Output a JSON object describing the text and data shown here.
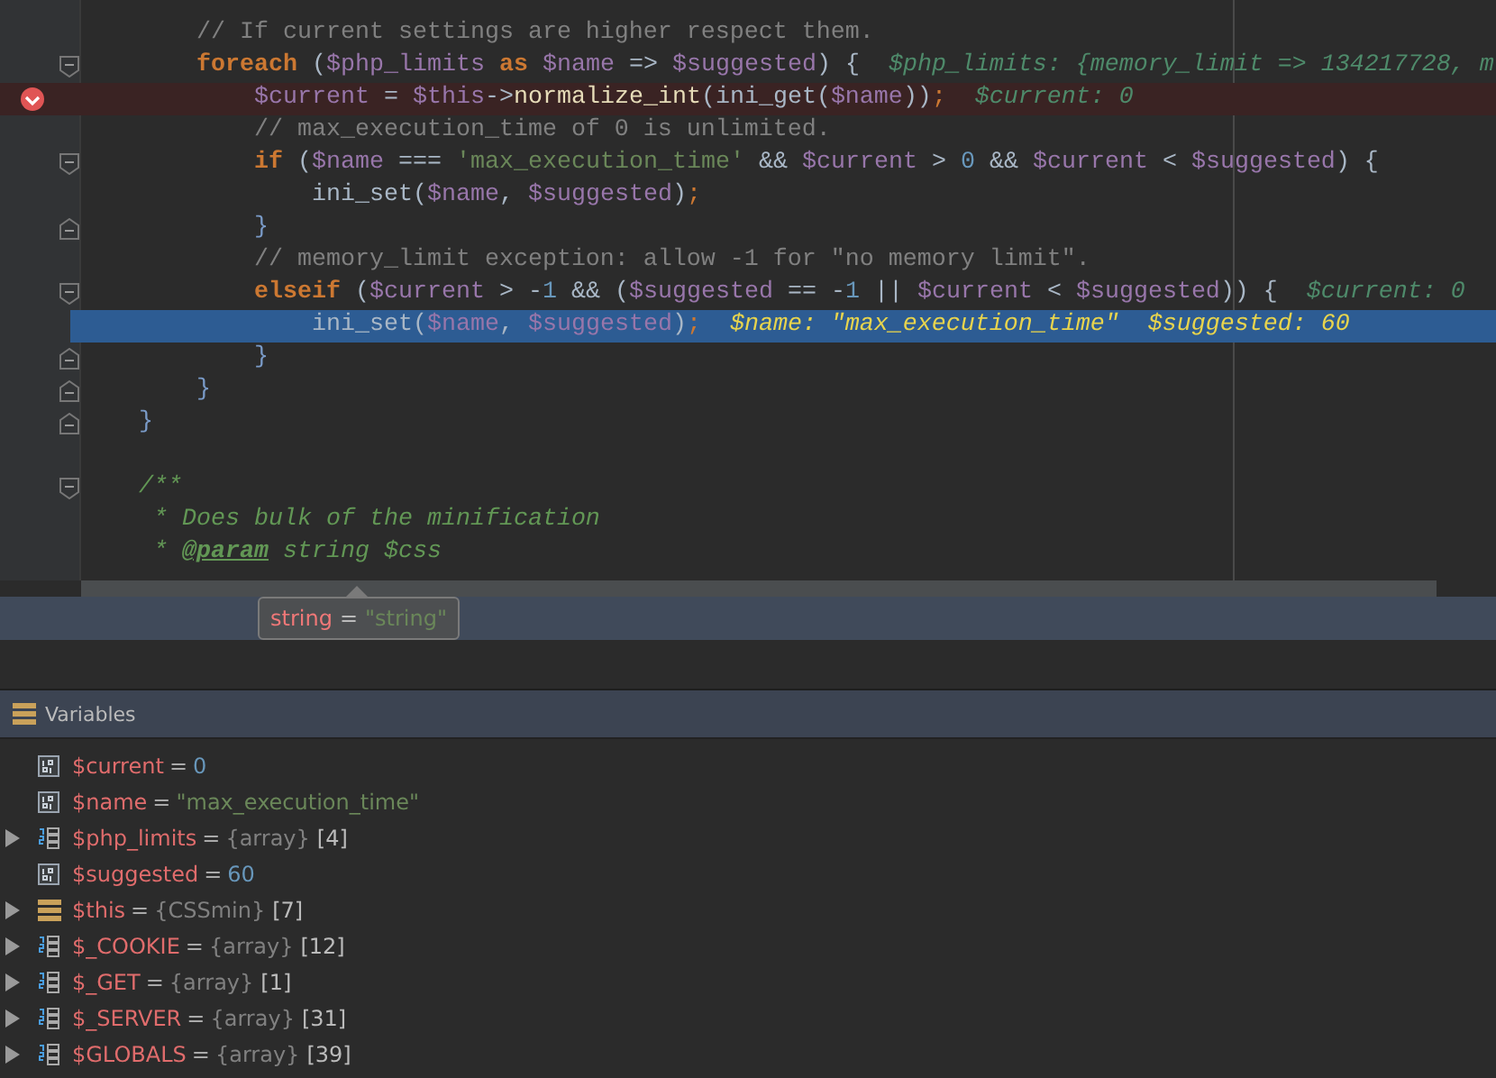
{
  "editor": {
    "lines": [
      {
        "kind": "code",
        "breakpoint": false,
        "current": false,
        "tokens": [
          {
            "kind": "comment",
            "text": "        // If current settings are higher respect them."
          }
        ]
      },
      {
        "kind": "fold-start",
        "breakpoint": false,
        "current": false,
        "tokens": [
          {
            "kind": "keyword",
            "text": "        foreach"
          },
          {
            "kind": "plain",
            "text": " ("
          },
          {
            "kind": "var",
            "text": "$php_limits"
          },
          {
            "kind": "keyword",
            "text": " as "
          },
          {
            "kind": "var",
            "text": "$name"
          },
          {
            "kind": "plain",
            "text": " => "
          },
          {
            "kind": "var",
            "text": "$suggested"
          },
          {
            "kind": "plain",
            "text": ") {"
          },
          {
            "kind": "hint",
            "text": "  $php_limits: {memory_limit => 134217728, m"
          }
        ]
      },
      {
        "kind": "code",
        "breakpoint": true,
        "current": false,
        "tokens": [
          {
            "kind": "var",
            "text": "            $current"
          },
          {
            "kind": "plain",
            "text": " = "
          },
          {
            "kind": "var",
            "text": "$this"
          },
          {
            "kind": "plain",
            "text": "->"
          },
          {
            "kind": "method",
            "text": "normalize_int"
          },
          {
            "kind": "plain",
            "text": "(ini_get("
          },
          {
            "kind": "var",
            "text": "$name"
          },
          {
            "kind": "plain",
            "text": "))"
          },
          {
            "kind": "keyword-plain",
            "text": ";"
          },
          {
            "kind": "hint",
            "text": "  $current: 0"
          }
        ]
      },
      {
        "kind": "code",
        "breakpoint": false,
        "current": false,
        "tokens": [
          {
            "kind": "comment",
            "text": "            // max_execution_time of 0 is unlimited."
          }
        ]
      },
      {
        "kind": "fold-start",
        "breakpoint": false,
        "current": false,
        "tokens": [
          {
            "kind": "keyword",
            "text": "            if"
          },
          {
            "kind": "plain",
            "text": " ("
          },
          {
            "kind": "var",
            "text": "$name"
          },
          {
            "kind": "plain",
            "text": " === "
          },
          {
            "kind": "string",
            "text": "'max_execution_time'"
          },
          {
            "kind": "plain",
            "text": " && "
          },
          {
            "kind": "var",
            "text": "$current"
          },
          {
            "kind": "plain",
            "text": " > "
          },
          {
            "kind": "number",
            "text": "0"
          },
          {
            "kind": "plain",
            "text": " && "
          },
          {
            "kind": "var",
            "text": "$current"
          },
          {
            "kind": "plain",
            "text": " < "
          },
          {
            "kind": "var",
            "text": "$suggested"
          },
          {
            "kind": "plain",
            "text": ") {"
          }
        ]
      },
      {
        "kind": "code",
        "breakpoint": false,
        "current": false,
        "tokens": [
          {
            "kind": "plain",
            "text": "                ini_set("
          },
          {
            "kind": "var",
            "text": "$name"
          },
          {
            "kind": "plain",
            "text": ", "
          },
          {
            "kind": "var",
            "text": "$suggested"
          },
          {
            "kind": "plain",
            "text": ")"
          },
          {
            "kind": "keyword-plain",
            "text": ";"
          }
        ]
      },
      {
        "kind": "fold-end",
        "breakpoint": false,
        "current": false,
        "tokens": [
          {
            "kind": "brace",
            "text": "            }"
          }
        ]
      },
      {
        "kind": "code",
        "breakpoint": false,
        "current": false,
        "tokens": [
          {
            "kind": "comment",
            "text": "            // memory_limit exception: allow -1 for \"no memory limit\"."
          }
        ]
      },
      {
        "kind": "fold-start",
        "breakpoint": false,
        "current": false,
        "tokens": [
          {
            "kind": "keyword",
            "text": "            elseif"
          },
          {
            "kind": "plain",
            "text": " ("
          },
          {
            "kind": "var",
            "text": "$current"
          },
          {
            "kind": "plain",
            "text": " > -"
          },
          {
            "kind": "number",
            "text": "1"
          },
          {
            "kind": "plain",
            "text": " && ("
          },
          {
            "kind": "var",
            "text": "$suggested"
          },
          {
            "kind": "plain",
            "text": " == -"
          },
          {
            "kind": "number",
            "text": "1"
          },
          {
            "kind": "plain",
            "text": " || "
          },
          {
            "kind": "var",
            "text": "$current"
          },
          {
            "kind": "plain",
            "text": " < "
          },
          {
            "kind": "var",
            "text": "$suggested"
          },
          {
            "kind": "plain",
            "text": ")) {"
          },
          {
            "kind": "hint",
            "text": "  $current: 0"
          }
        ]
      },
      {
        "kind": "code",
        "breakpoint": false,
        "current": true,
        "tokens": [
          {
            "kind": "plain",
            "text": "                ini_set("
          },
          {
            "kind": "var",
            "text": "$name"
          },
          {
            "kind": "plain",
            "text": ", "
          },
          {
            "kind": "var",
            "text": "$suggested"
          },
          {
            "kind": "plain",
            "text": ")"
          },
          {
            "kind": "keyword-plain",
            "text": ";"
          },
          {
            "kind": "exec-hint",
            "text": "  $name: \"max_execution_time\"  $suggested: 60"
          }
        ]
      },
      {
        "kind": "fold-end",
        "breakpoint": false,
        "current": false,
        "tokens": [
          {
            "kind": "brace",
            "text": "            }"
          }
        ]
      },
      {
        "kind": "fold-end",
        "breakpoint": false,
        "current": false,
        "tokens": [
          {
            "kind": "brace",
            "text": "        }"
          }
        ]
      },
      {
        "kind": "fold-end",
        "breakpoint": false,
        "current": false,
        "tokens": [
          {
            "kind": "brace",
            "text": "    }"
          }
        ]
      },
      {
        "kind": "blank",
        "breakpoint": false,
        "current": false
      },
      {
        "kind": "fold-start",
        "breakpoint": false,
        "current": false,
        "tokens": [
          {
            "kind": "doc",
            "text": "    /**"
          }
        ]
      },
      {
        "kind": "code",
        "breakpoint": false,
        "current": false,
        "tokens": [
          {
            "kind": "doc",
            "text": "     * Does bulk of the minification"
          }
        ]
      },
      {
        "kind": "code",
        "breakpoint": false,
        "current": false,
        "tokens": [
          {
            "kind": "doc",
            "text": "     * "
          },
          {
            "kind": "doc-tag",
            "text": "@param"
          },
          {
            "kind": "doc",
            "text": " string $css"
          }
        ]
      }
    ]
  },
  "tooltip": {
    "name": "string",
    "op": "=",
    "value": "\"string\""
  },
  "variables": {
    "title": "Variables",
    "items": [
      {
        "kind": "primitive",
        "name": "$current",
        "op": "=",
        "value": {
          "kind": "number",
          "text": "0"
        }
      },
      {
        "kind": "primitive",
        "name": "$name",
        "op": "=",
        "value": {
          "kind": "string",
          "text": "\"max_execution_time\""
        }
      },
      {
        "kind": "array",
        "expanded": false,
        "name": "$php_limits",
        "op": "=",
        "value": {
          "kind": "type",
          "text": "{array}"
        },
        "count": "[4]"
      },
      {
        "kind": "primitive",
        "name": "$suggested",
        "op": "=",
        "value": {
          "kind": "number",
          "text": "60"
        }
      },
      {
        "kind": "object",
        "expanded": false,
        "name": "$this",
        "op": "=",
        "value": {
          "kind": "type",
          "text": "{CSSmin}"
        },
        "count": "[7]"
      },
      {
        "kind": "array",
        "expanded": false,
        "name": "$_COOKIE",
        "op": "=",
        "value": {
          "kind": "type",
          "text": "{array}"
        },
        "count": "[12]"
      },
      {
        "kind": "array",
        "expanded": false,
        "name": "$_GET",
        "op": "=",
        "value": {
          "kind": "type",
          "text": "{array}"
        },
        "count": "[1]"
      },
      {
        "kind": "array",
        "expanded": false,
        "name": "$_SERVER",
        "op": "=",
        "value": {
          "kind": "type",
          "text": "{array}"
        },
        "count": "[31]"
      },
      {
        "kind": "array",
        "expanded": false,
        "name": "$GLOBALS",
        "op": "=",
        "value": {
          "kind": "type",
          "text": "{array}"
        },
        "count": "[39]"
      }
    ]
  }
}
